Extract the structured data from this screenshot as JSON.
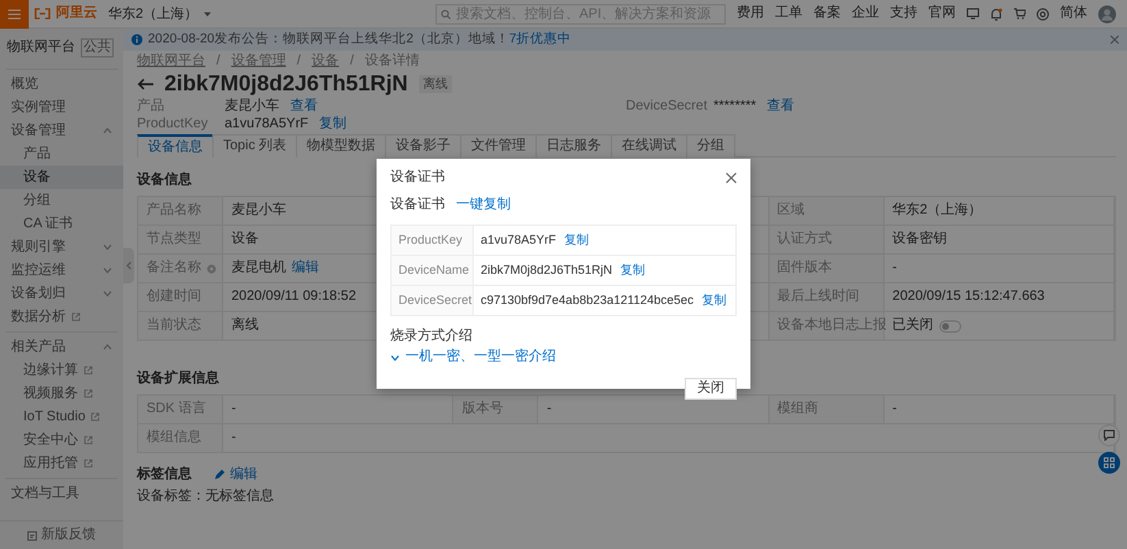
{
  "top_bar": {
    "logo": "阿里云",
    "region": "华东2（上海）",
    "search": {
      "placeholder": "搜索文档、控制台、API、解决方案和资源"
    },
    "links": [
      "费用",
      "工单",
      "备案",
      "企业",
      "支持",
      "官网"
    ],
    "language": "简体"
  },
  "notice": {
    "text": "2020-08-20发布公告：物联网平台上线华北2（北京）地域！",
    "link": "7折优惠中"
  },
  "sidebar": {
    "title": "物联网平台",
    "tag": "公共",
    "sections": [
      {
        "items": [
          {
            "kind": "link",
            "label": "概览",
            "selected": false,
            "external": false
          },
          {
            "kind": "link",
            "label": "实例管理",
            "selected": false,
            "external": false
          },
          {
            "kind": "group",
            "label": "设备管理",
            "expanded": true,
            "children": [
              {
                "label": "产品",
                "selected": false,
                "external": false
              },
              {
                "label": "设备",
                "selected": true,
                "external": false
              },
              {
                "label": "分组",
                "selected": false,
                "external": false
              },
              {
                "label": "CA 证书",
                "selected": false,
                "external": false
              }
            ]
          },
          {
            "kind": "group",
            "label": "规则引擎",
            "expanded": false
          },
          {
            "kind": "group",
            "label": "监控运维",
            "expanded": false
          },
          {
            "kind": "group",
            "label": "设备划归",
            "expanded": false
          },
          {
            "kind": "link",
            "label": "数据分析",
            "selected": false,
            "external": true
          }
        ]
      },
      {
        "items": [
          {
            "kind": "group",
            "label": "相关产品",
            "expanded": true,
            "children": [
              {
                "label": "边缘计算",
                "selected": false,
                "external": true
              },
              {
                "label": "视频服务",
                "selected": false,
                "external": true
              },
              {
                "label": "IoT Studio",
                "selected": false,
                "external": true
              },
              {
                "label": "安全中心",
                "selected": false,
                "external": true
              },
              {
                "label": "应用托管",
                "selected": false,
                "external": true
              }
            ]
          }
        ]
      },
      {
        "items": [
          {
            "kind": "link",
            "label": "文档与工具",
            "selected": false,
            "external": false
          }
        ]
      }
    ],
    "feedback": "新版反馈"
  },
  "breadcrumb": [
    "物联网平台",
    "设备管理",
    "设备",
    "设备详情"
  ],
  "breadcrumb_separator": "/",
  "title": "2ibk7M0j8d2J6Th51RjN",
  "status": "离线",
  "meta": [
    {
      "label": "产品",
      "value": "麦昆小车",
      "link": "查看"
    },
    {
      "label": "DeviceSecret",
      "value": "********",
      "link": "查看"
    },
    {
      "label": "ProductKey",
      "value": "a1vu78A5YrF",
      "link": "复制"
    }
  ],
  "tabs": [
    {
      "label": "设备信息",
      "selected": true
    },
    {
      "label": "Topic 列表",
      "selected": false
    },
    {
      "label": "物模型数据",
      "selected": false
    },
    {
      "label": "设备影子",
      "selected": false
    },
    {
      "label": "文件管理",
      "selected": false
    },
    {
      "label": "日志服务",
      "selected": false
    },
    {
      "label": "在线调试",
      "selected": false
    },
    {
      "label": "分组",
      "selected": false
    }
  ],
  "device_info": {
    "title": "设备信息",
    "rows": [
      {
        "left": {
          "kind": "text",
          "label": "产品名称",
          "value": "麦昆小车"
        },
        "right": {
          "kind": "text",
          "label": "区域",
          "value": "华东2（上海）"
        }
      },
      {
        "left": {
          "kind": "text",
          "label": "节点类型",
          "value": "设备"
        },
        "right": {
          "kind": "text",
          "label": "认证方式",
          "value": "设备密钥"
        }
      },
      {
        "left": {
          "kind": "text",
          "label": "备注名称",
          "info": true,
          "value": "麦昆电机",
          "link": "编辑"
        },
        "right": {
          "kind": "text",
          "label": "固件版本",
          "value": "-"
        }
      },
      {
        "left": {
          "kind": "text",
          "label": "创建时间",
          "value": "2020/09/11 09:18:52"
        },
        "right": {
          "kind": "text",
          "label": "最后上线时间",
          "value": "2020/09/15 15:12:47.663"
        }
      },
      {
        "left": {
          "kind": "text",
          "label": "当前状态",
          "value": "离线"
        },
        "right": {
          "kind": "toggle",
          "label": "设备本地日志上报",
          "value": "已关闭",
          "on": false
        }
      }
    ]
  },
  "ext_info": {
    "title": "设备扩展信息",
    "rows": [
      [
        {
          "label": "SDK 语言",
          "value": "-"
        },
        {
          "label": "版本号",
          "value": "-"
        },
        {
          "label": "模组商",
          "value": "-"
        }
      ],
      [
        {
          "label": "模组信息",
          "value": "-"
        }
      ]
    ]
  },
  "tags": {
    "title": "标签信息",
    "edit": "编辑",
    "label": "设备标签：",
    "value": "无标签信息"
  },
  "modal": {
    "title": "设备证书",
    "section": "设备证书",
    "copy_all": "一键复制",
    "rows": [
      {
        "label": "ProductKey",
        "value": "a1vu78A5YrF",
        "link": "复制"
      },
      {
        "label": "DeviceName",
        "value": "2ibk7M0j8d2J6Th51RjN",
        "link": "复制"
      },
      {
        "label": "DeviceSecret",
        "value": "c97130bf9d7e4ab8b23a121124bce5ec",
        "link": "复制"
      }
    ],
    "burn_title": "烧录方式介绍",
    "burn_link": {
      "label": "一机一密、一型一密介绍",
      "expanded": false
    },
    "button": "关闭"
  }
}
